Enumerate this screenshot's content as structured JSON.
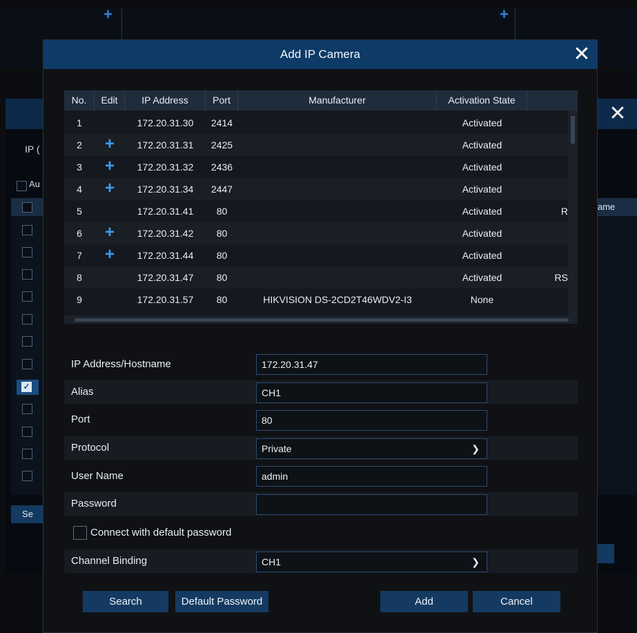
{
  "dialog": {
    "title": "Add IP Camera",
    "close_icon": "close-icon"
  },
  "background": {
    "close_icon": "close-icon",
    "ip_label_fragment": "IP (",
    "auto_label_fragment": "Au",
    "column_fragment": "ame",
    "button_fragment": "Sе"
  },
  "table": {
    "headers": {
      "no": "No.",
      "edit": "Edit",
      "ip": "IP Address",
      "port": "Port",
      "manufacturer": "Manufacturer",
      "activation": "Activation State"
    },
    "rows": [
      {
        "no": "1",
        "edit": false,
        "ip": "172.20.31.30",
        "port": "2414",
        "manufacturer": "",
        "activation": "Activated",
        "extra": ""
      },
      {
        "no": "2",
        "edit": true,
        "ip": "172.20.31.31",
        "port": "2425",
        "manufacturer": "",
        "activation": "Activated",
        "extra": ""
      },
      {
        "no": "3",
        "edit": true,
        "ip": "172.20.31.32",
        "port": "2436",
        "manufacturer": "",
        "activation": "Activated",
        "extra": ""
      },
      {
        "no": "4",
        "edit": true,
        "ip": "172.20.31.34",
        "port": "2447",
        "manufacturer": "",
        "activation": "Activated",
        "extra": ""
      },
      {
        "no": "5",
        "edit": false,
        "ip": "172.20.31.41",
        "port": "80",
        "manufacturer": "",
        "activation": "Activated",
        "extra": "R"
      },
      {
        "no": "6",
        "edit": true,
        "ip": "172.20.31.42",
        "port": "80",
        "manufacturer": "",
        "activation": "Activated",
        "extra": ""
      },
      {
        "no": "7",
        "edit": true,
        "ip": "172.20.31.44",
        "port": "80",
        "manufacturer": "",
        "activation": "Activated",
        "extra": ""
      },
      {
        "no": "8",
        "edit": false,
        "ip": "172.20.31.47",
        "port": "80",
        "manufacturer": "",
        "activation": "Activated",
        "extra": "RS"
      },
      {
        "no": "9",
        "edit": false,
        "ip": "172.20.31.57",
        "port": "80",
        "manufacturer": "HIKVISION DS-2CD2T46WDV2-I3",
        "activation": "None",
        "extra": ""
      }
    ]
  },
  "form": {
    "ip_label": "IP Address/Hostname",
    "ip_value": "172.20.31.47",
    "alias_label": "Alias",
    "alias_value": "CH1",
    "port_label": "Port",
    "port_value": "80",
    "protocol_label": "Protocol",
    "protocol_value": "Private",
    "username_label": "User Name",
    "username_value": "admin",
    "password_label": "Password",
    "password_value": "",
    "default_password_checkbox": "Connect with default password",
    "default_password_checked": false,
    "channel_label": "Channel Binding",
    "channel_value": "CH1"
  },
  "buttons": {
    "search": "Search",
    "default_password": "Default Password",
    "add": "Add",
    "cancel": "Cancel"
  },
  "colors": {
    "title_bar": "#0d3a66",
    "button": "#143a61",
    "plus_icon": "#3b9cf0"
  }
}
